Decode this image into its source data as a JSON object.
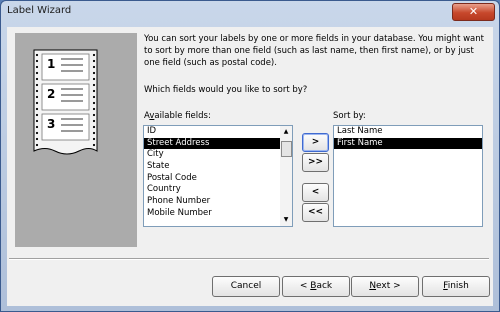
{
  "window": {
    "title": "Label Wizard",
    "close_glyph": "✕"
  },
  "illustration": {
    "labels": [
      "1",
      "2",
      "3"
    ]
  },
  "description": "You can sort your labels by one or more fields in your database.  You might want to sort by more than one field (such as last name, then first name), or by just one field (such as postal code).",
  "question": "Which fields would you like to sort by?",
  "available": {
    "label_pre": "A",
    "label_accel": "v",
    "label_post": "ailable fields:",
    "items": [
      "ID",
      "Street Address",
      "City",
      "State",
      "Postal Code",
      "Country",
      "Phone Number",
      "Mobile Number"
    ],
    "selected_index": 1
  },
  "sortby": {
    "label_pre": "",
    "label_accel": "",
    "label_post": "Sort by:",
    "items": [
      "Last Name",
      "First Name"
    ],
    "selected_index": 1
  },
  "move_buttons": {
    "add_one": ">",
    "add_all": ">>",
    "remove_one": "<",
    "remove_all": "<<"
  },
  "scrollbar": {
    "up": "▲",
    "down": "▼"
  },
  "footer": {
    "cancel": "Cancel",
    "back_accel": "B",
    "back_label": "ack",
    "back_prefix": "< ",
    "next_accel": "N",
    "next_label": "ext",
    "next_suffix": " >",
    "finish_accel": "F",
    "finish_label": "inish"
  }
}
